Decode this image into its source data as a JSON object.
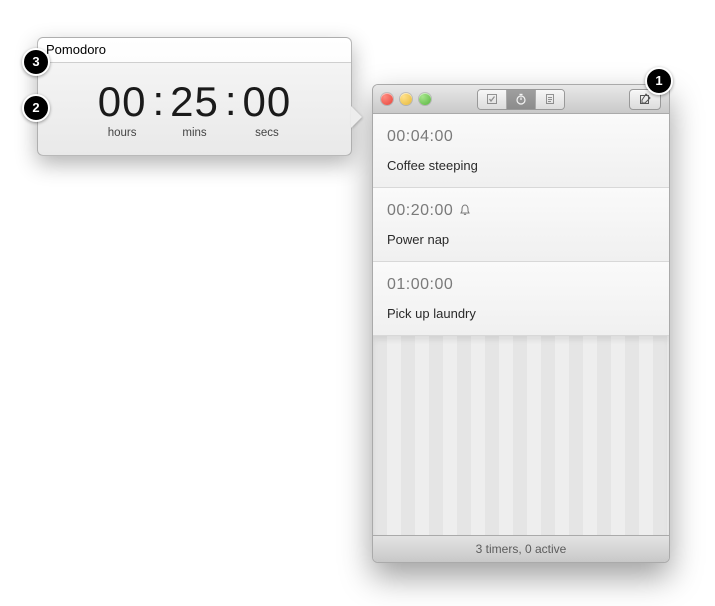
{
  "annotations": {
    "n1": "1",
    "n2": "2",
    "n3": "3"
  },
  "popover": {
    "title": "Pomodoro",
    "hours": "00",
    "mins": "25",
    "secs": "00",
    "hours_label": "hours",
    "mins_label": "mins",
    "secs_label": "secs"
  },
  "window": {
    "timers": [
      {
        "time": "00:04:00",
        "label": "Coffee steeping",
        "alarm": false
      },
      {
        "time": "00:20:00",
        "label": "Power nap",
        "alarm": true
      },
      {
        "time": "01:00:00",
        "label": "Pick up laundry",
        "alarm": false
      }
    ],
    "tabs": {
      "reminders_active": false,
      "timers_active": true,
      "notes_active": false
    },
    "status": "3 timers, 0 active"
  }
}
